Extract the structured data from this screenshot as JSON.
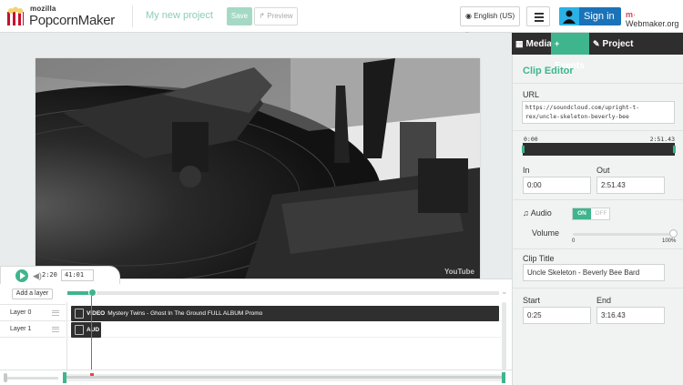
{
  "header": {
    "logo_top": "mozilla",
    "logo_name": "PopcornMaker",
    "project_name": "My new project",
    "save_label": "Save",
    "preview_label": "Preview",
    "language": "English (US)",
    "signin_label": "Sign in",
    "webmaker_label": "Webmaker.org"
  },
  "player": {
    "current_time": "2:20",
    "separator": "/",
    "duration": "41:01",
    "watermark": "YouTube"
  },
  "timeline": {
    "add_layer_label": "Add a layer",
    "layers": [
      {
        "name": "Layer 0"
      },
      {
        "name": "Layer 1"
      }
    ],
    "events": [
      {
        "type": "VIDEO",
        "title": "Mystery Twins - Ghost In The Ground FULL ALBUM Promo"
      },
      {
        "type": "AUD",
        "title": ""
      }
    ]
  },
  "panel": {
    "tabs": [
      {
        "label": "Media",
        "icon": "film-icon"
      },
      {
        "label": "Events",
        "icon": "plus-icon",
        "active": true
      },
      {
        "label": "Project",
        "icon": "edit-icon"
      }
    ],
    "title": "Clip Editor",
    "url_label": "URL",
    "url_value": "https://soundcloud.com/upright-t-rex/uncle-skeleton-beverly-bee",
    "range_start": "0:00",
    "range_end": "2:51.43",
    "in_label": "In",
    "in_value": "0:00",
    "out_label": "Out",
    "out_value": "2:51.43",
    "audio_label": "Audio",
    "audio_on": "ON",
    "audio_off": "OFF",
    "volume_label": "Volume",
    "volume_min": "0",
    "volume_max": "100%",
    "volume_level_percent": 100,
    "clip_title_label": "Clip Title",
    "clip_title_value": "Uncle Skeleton - Beverly Bee Bard",
    "start_label": "Start",
    "start_value": "0:25",
    "end_label": "End",
    "end_value": "3:16.43"
  },
  "colors": {
    "accent": "#3fb58d",
    "signin": "#1a73b8",
    "event_block": "#2f2f2f",
    "playhead": "#ee4444"
  }
}
